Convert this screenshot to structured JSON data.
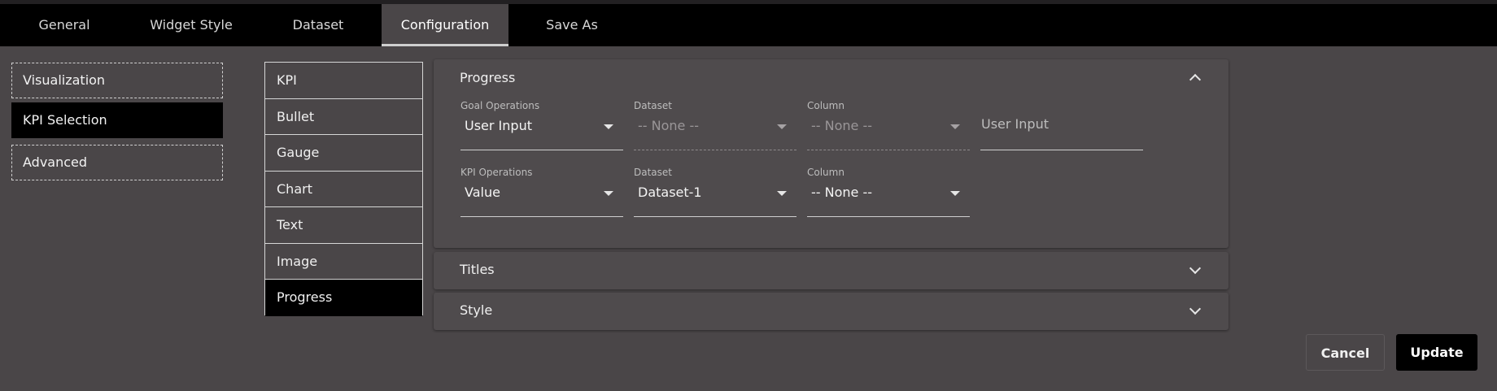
{
  "tabs": [
    {
      "label": "General"
    },
    {
      "label": "Widget Style"
    },
    {
      "label": "Dataset"
    },
    {
      "label": "Configuration"
    },
    {
      "label": "Save As"
    }
  ],
  "sidebar": {
    "items": [
      {
        "label": "Visualization"
      },
      {
        "label": "KPI Selection"
      },
      {
        "label": "Advanced"
      }
    ]
  },
  "kpi_types": [
    {
      "label": "KPI"
    },
    {
      "label": "Bullet"
    },
    {
      "label": "Gauge"
    },
    {
      "label": "Chart"
    },
    {
      "label": "Text"
    },
    {
      "label": "Image"
    },
    {
      "label": "Progress"
    }
  ],
  "progress_panel": {
    "title": "Progress",
    "goal_operations": {
      "label": "Goal Operations",
      "value": "User Input"
    },
    "goal_dataset": {
      "label": "Dataset",
      "value": "-- None --"
    },
    "goal_column": {
      "label": "Column",
      "value": "-- None --"
    },
    "goal_user_input": {
      "placeholder": "User Input"
    },
    "kpi_operations": {
      "label": "KPI Operations",
      "value": "Value"
    },
    "kpi_dataset": {
      "label": "Dataset",
      "value": "Dataset-1"
    },
    "kpi_column": {
      "label": "Column",
      "value": "-- None --"
    }
  },
  "titles_panel": {
    "title": "Titles"
  },
  "style_panel": {
    "title": "Style"
  },
  "footer": {
    "cancel_label": "Cancel",
    "update_label": "Update"
  }
}
